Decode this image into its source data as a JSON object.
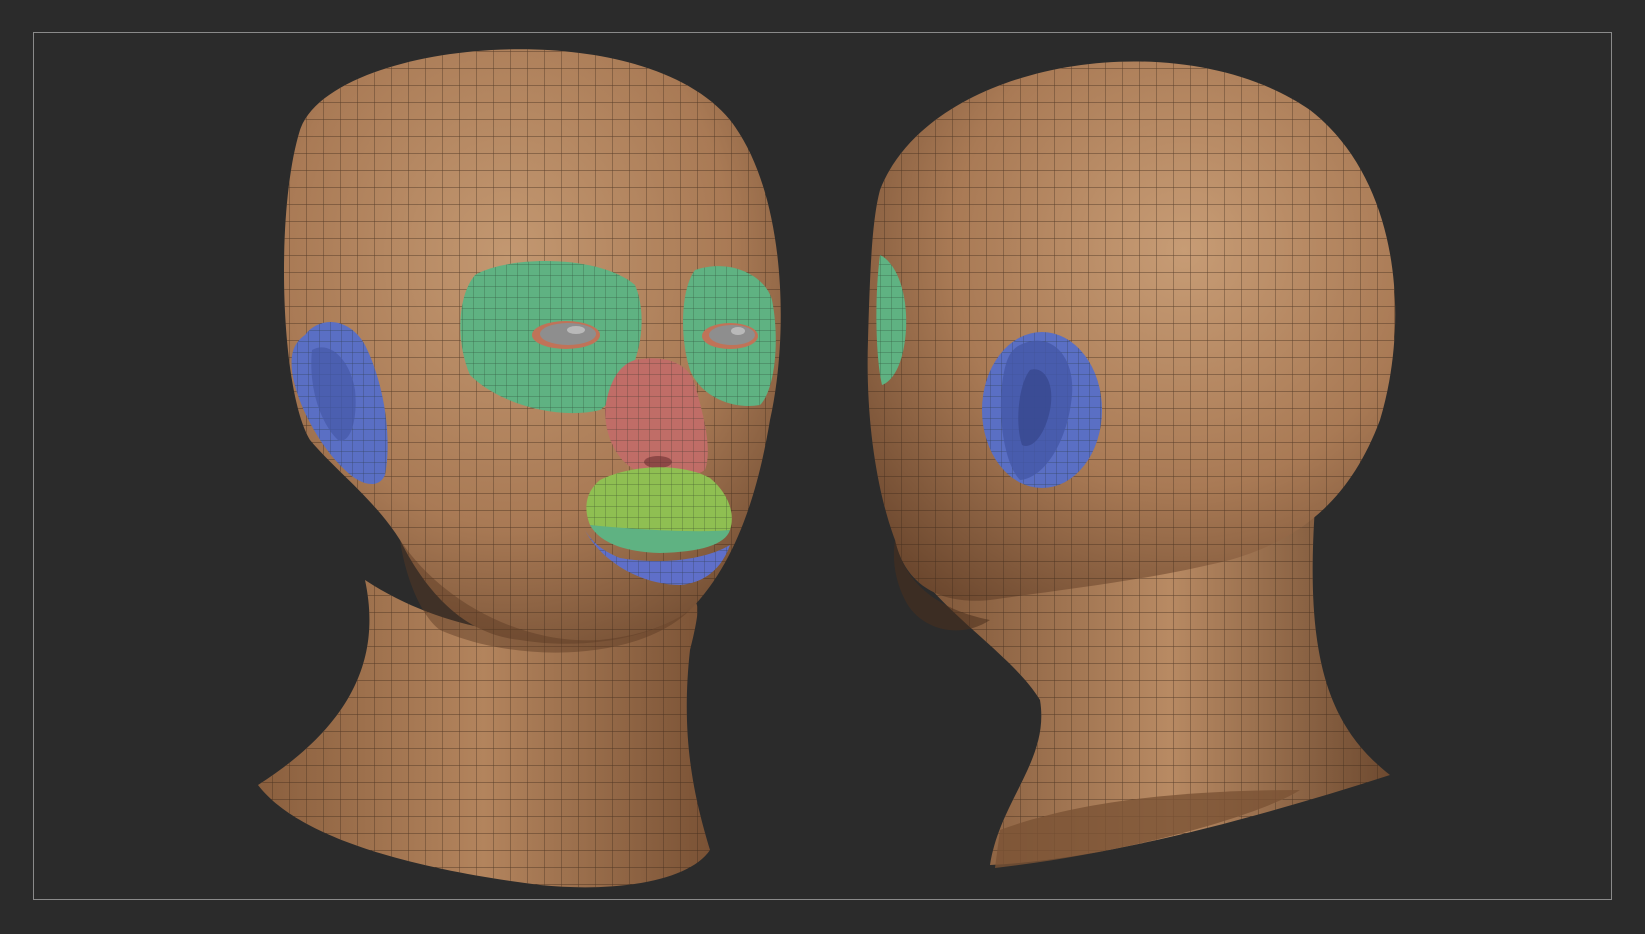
{
  "scene": {
    "background_color": "#2b2b2b",
    "frame_color": "#8a8a8a",
    "skin_color": "#a97a55",
    "skin_highlight": "#c39871",
    "skin_shadow": "#6e4a30",
    "wire_color": "#3a2618",
    "polygroup_colors": {
      "eye_region": "#5fb282",
      "nose": "#c06d67",
      "upper_lip": "#8fbf52",
      "lower_lip": "#5f6fc9",
      "ear": "#5a6fc4",
      "eyeball": "#8e8e8e"
    },
    "views": [
      {
        "name": "three-quarter-front"
      },
      {
        "name": "side-back"
      }
    ]
  }
}
